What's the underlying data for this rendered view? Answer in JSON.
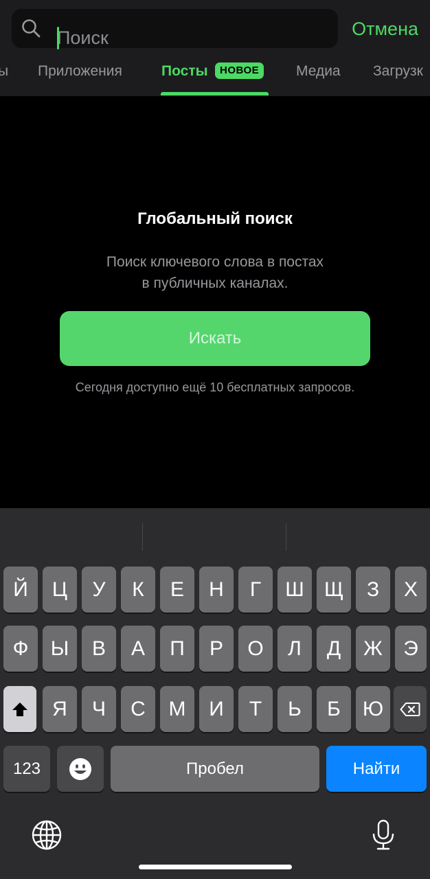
{
  "search": {
    "placeholder": "Поиск",
    "cancel_label": "Отмена"
  },
  "tabs": [
    {
      "label": "ы"
    },
    {
      "label": "Приложения"
    },
    {
      "label": "Посты",
      "badge": "НОВОЕ",
      "active": true
    },
    {
      "label": "Медиа"
    },
    {
      "label": "Загрузк"
    }
  ],
  "content": {
    "title": "Глобальный поиск",
    "description_line1": "Поиск ключевого слова в постах",
    "description_line2": "в публичных каналах.",
    "button_label": "Искать",
    "quota": "Сегодня доступно ещё 10 бесплатных запросов."
  },
  "keyboard": {
    "row1": [
      "Й",
      "Ц",
      "У",
      "К",
      "Е",
      "Н",
      "Г",
      "Ш",
      "Щ",
      "З",
      "Х"
    ],
    "row2": [
      "Ф",
      "Ы",
      "В",
      "А",
      "П",
      "Р",
      "О",
      "Л",
      "Д",
      "Ж",
      "Э"
    ],
    "row3": [
      "Я",
      "Ч",
      "С",
      "М",
      "И",
      "Т",
      "Ь",
      "Б",
      "Ю"
    ],
    "numbers_label": "123",
    "space_label": "Пробел",
    "go_label": "Найти",
    "icons": [
      "shift-icon",
      "backspace-icon",
      "emoji-icon",
      "globe-icon",
      "microphone-icon"
    ]
  },
  "colors": {
    "accent": "#4cd964",
    "button": "#54d66d",
    "go": "#0a84ff",
    "keyboard_bg": "#2c2c2e",
    "key": "#6d6d70"
  }
}
